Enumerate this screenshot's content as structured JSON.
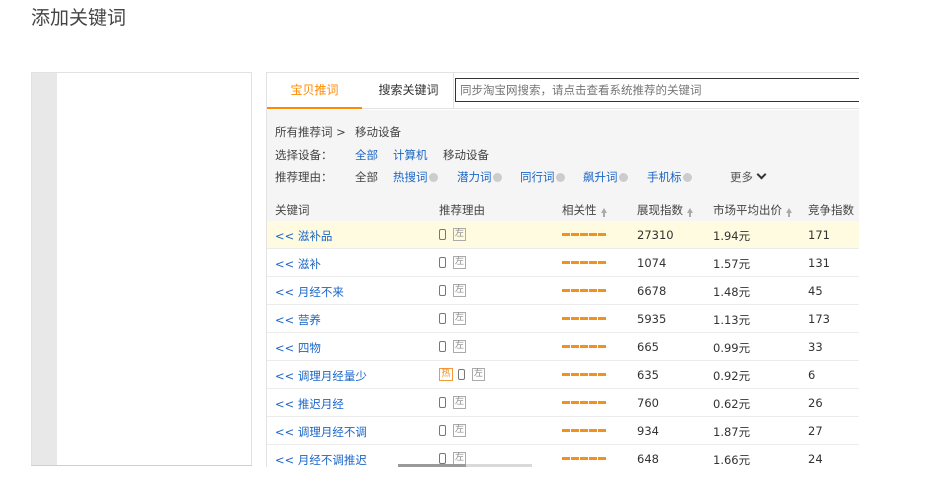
{
  "page_title": "添加关键词",
  "tabs": {
    "active": "宝贝推词",
    "second": "搜索关键词"
  },
  "search": {
    "placeholder": "同步淘宝网搜索，请点击查看系统推荐的关键词"
  },
  "breadcrumb": {
    "root": "所有推荐词 >",
    "current": "移动设备"
  },
  "device_filter": {
    "label": "选择设备：",
    "options": [
      "全部",
      "计算机",
      "移动设备"
    ],
    "selected": "移动设备"
  },
  "reason_filter": {
    "label": "推荐理由：",
    "options": [
      "全部",
      "热搜词",
      "潜力词",
      "同行词",
      "飙升词",
      "手机标"
    ],
    "selected": "全部",
    "more_label": "更多"
  },
  "table": {
    "headers": {
      "keyword": "关键词",
      "reason": "推荐理由",
      "relevance": "相关性",
      "impressions": "展现指数",
      "avg_price": "市场平均出价",
      "competition": "竞争指数"
    },
    "reason_icons": {
      "left_badge": "左",
      "hot_badge": "热"
    },
    "rows": [
      {
        "keyword": "<< 滋补品",
        "impressions": "27310",
        "avg_price": "1.94元",
        "competition": "171",
        "hot": false,
        "highlight": true
      },
      {
        "keyword": "<< 滋补",
        "impressions": "1074",
        "avg_price": "1.57元",
        "competition": "131",
        "hot": false,
        "highlight": false
      },
      {
        "keyword": "<< 月经不来",
        "impressions": "6678",
        "avg_price": "1.48元",
        "competition": "45",
        "hot": false,
        "highlight": false
      },
      {
        "keyword": "<< 营养",
        "impressions": "5935",
        "avg_price": "1.13元",
        "competition": "173",
        "hot": false,
        "highlight": false
      },
      {
        "keyword": "<< 四物",
        "impressions": "665",
        "avg_price": "0.99元",
        "competition": "33",
        "hot": false,
        "highlight": false
      },
      {
        "keyword": "<< 调理月经量少",
        "impressions": "635",
        "avg_price": "0.92元",
        "competition": "6",
        "hot": true,
        "highlight": false
      },
      {
        "keyword": "<< 推迟月经",
        "impressions": "760",
        "avg_price": "0.62元",
        "competition": "26",
        "hot": false,
        "highlight": false
      },
      {
        "keyword": "<< 调理月经不调",
        "impressions": "934",
        "avg_price": "1.87元",
        "competition": "27",
        "hot": false,
        "highlight": false
      },
      {
        "keyword": "<< 月经不调推迟",
        "impressions": "648",
        "avg_price": "1.66元",
        "competition": "24",
        "hot": false,
        "highlight": false
      }
    ]
  },
  "colors": {
    "accent": "#ff8a00",
    "link": "#1a66c8",
    "relevance_bar": "#f0921c",
    "highlight_row": "#fffbe0"
  }
}
